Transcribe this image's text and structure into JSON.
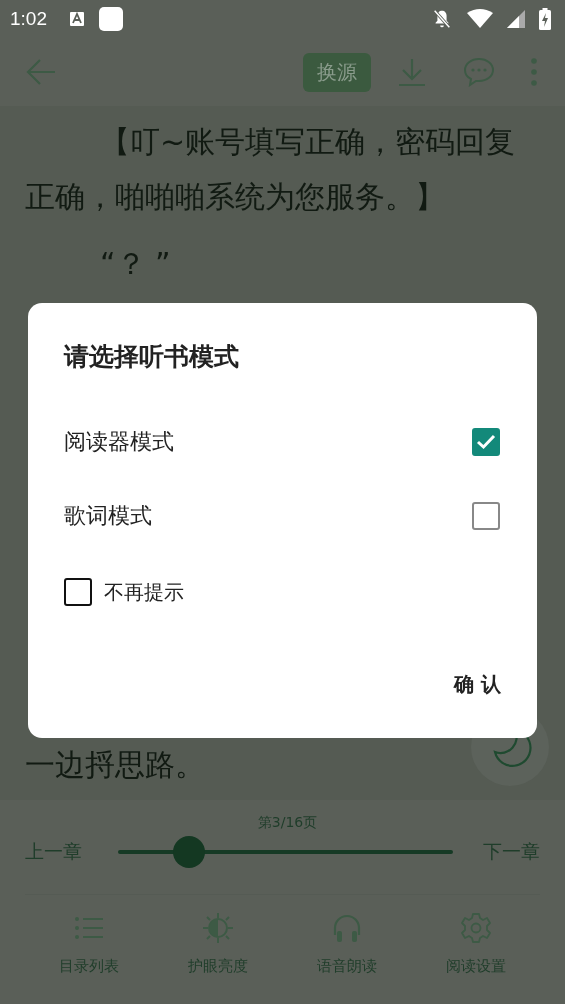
{
  "status_bar": {
    "time": "1:02"
  },
  "toolbar": {
    "source_button": "换源"
  },
  "content": {
    "lines": [
      "【叮~账号填写正确，密码回复正确，啪啪啪系统为您服务。】",
      "“？ ”"
    ],
    "last_line": "一边捋思路。"
  },
  "dialog": {
    "title": "请选择听书模式",
    "options": [
      {
        "label": "阅读器模式",
        "checked": true
      },
      {
        "label": "歌词模式",
        "checked": false
      }
    ],
    "dont_remind": {
      "label": "不再提示",
      "checked": false
    },
    "confirm": "确 认"
  },
  "reader_bar": {
    "page": "第3/16页",
    "prev": "上一章",
    "next": "下一章",
    "progress": {
      "level": 0.18
    }
  },
  "bottom_nav": [
    {
      "label": "目录列表"
    },
    {
      "label": "护眼亮度"
    },
    {
      "label": "语音朗读"
    },
    {
      "label": "阅读设置"
    }
  ]
}
